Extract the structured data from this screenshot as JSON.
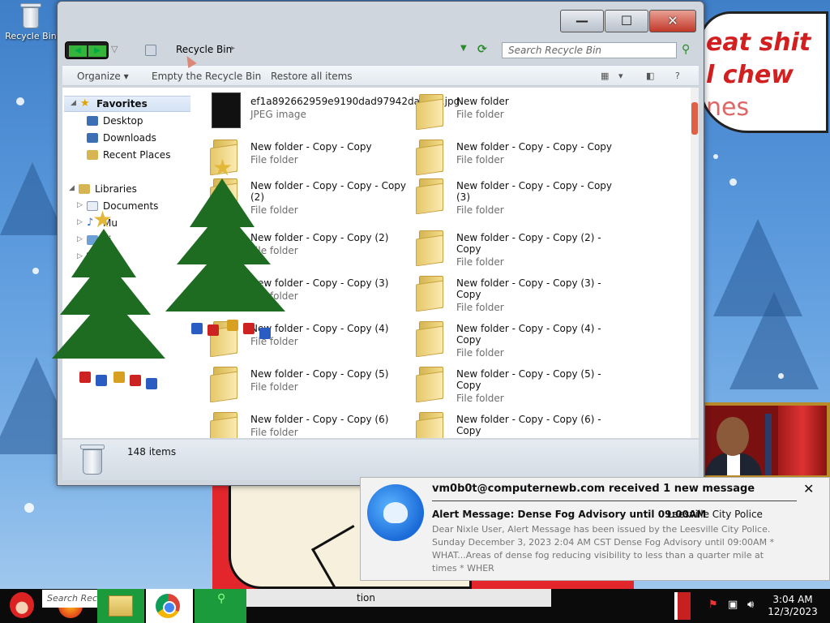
{
  "desktop": {
    "icons": [
      {
        "label": "Recycle Bin"
      }
    ],
    "speech_bubble": {
      "line1": "eat shit",
      "line2": "l chew",
      "line3": "nes"
    }
  },
  "window": {
    "title_buttons": {
      "minimize": "—",
      "maximize": "☐",
      "close": "✕"
    },
    "address": {
      "location": "Recycle Bin",
      "chevron": "▸"
    },
    "search": {
      "placeholder": "Search Recycle Bin"
    },
    "commands": {
      "organize": "Organize",
      "empty": "Empty the Recycle Bin",
      "restore": "Restore all items",
      "help": "?"
    },
    "nav": {
      "favorites": "Favorites",
      "favorite_items": [
        "Desktop",
        "Downloads",
        "Recent Places"
      ],
      "libraries": "Libraries",
      "library_items": [
        "Documents",
        "Mu",
        "Pi",
        ""
      ]
    },
    "files": [
      {
        "name": "ef1a892662959e9190dad97942daf95a.jpg",
        "type": "JPEG image",
        "kind": "image"
      },
      {
        "name": "New folder",
        "type": "File folder",
        "kind": "folder"
      },
      {
        "name": "New folder - Copy - Copy",
        "type": "File folder",
        "kind": "folder"
      },
      {
        "name": "New folder - Copy - Copy - Copy",
        "type": "File folder",
        "kind": "folder"
      },
      {
        "name": "New folder - Copy - Copy - Copy (2)",
        "type": "File folder",
        "kind": "folder"
      },
      {
        "name": "New folder - Copy - Copy - Copy (3)",
        "type": "File folder",
        "kind": "folder"
      },
      {
        "name": "New folder - Copy - Copy (2)",
        "type": "File folder",
        "kind": "folder"
      },
      {
        "name": "New folder - Copy - Copy (2) - Copy",
        "type": "File folder",
        "kind": "folder"
      },
      {
        "name": "New folder - Copy - Copy (3)",
        "type": "File folder",
        "kind": "folder"
      },
      {
        "name": "New folder - Copy - Copy (3) - Copy",
        "type": "File folder",
        "kind": "folder"
      },
      {
        "name": "New folder - Copy - Copy (4)",
        "type": "File folder",
        "kind": "folder"
      },
      {
        "name": "New folder - Copy - Copy (4) - Copy",
        "type": "File folder",
        "kind": "folder"
      },
      {
        "name": "New folder - Copy - Copy (5)",
        "type": "File folder",
        "kind": "folder"
      },
      {
        "name": "New folder - Copy - Copy (5) - Copy",
        "type": "File folder",
        "kind": "folder"
      },
      {
        "name": "New folder - Copy - Copy (6)",
        "type": "File folder",
        "kind": "folder"
      },
      {
        "name": "New folder - Copy - Copy (6) - Copy",
        "type": "File folder",
        "kind": "folder"
      }
    ],
    "status": {
      "count": "148 items"
    }
  },
  "notification": {
    "title": "vm0b0t@computernewb.com received 1 new message",
    "subject": "Alert Message: Dense Fog Advisory until 09:00AM",
    "sender": "Leesville City Police",
    "body": "Dear Nixle User, Alert Message has been issued by the Leesville City Police. Sunday December 3, 2023 2:04 AM CST Dense Fog Advisory until 09:00AM * WHAT...Areas of dense fog reducing visibility to less than a quarter mile at times * WHER",
    "close": "✕"
  },
  "taskbar": {
    "search_placeholder": "Search Recy",
    "strip_text": "tion",
    "time": "3:04 AM",
    "date": "12/3/2023"
  }
}
